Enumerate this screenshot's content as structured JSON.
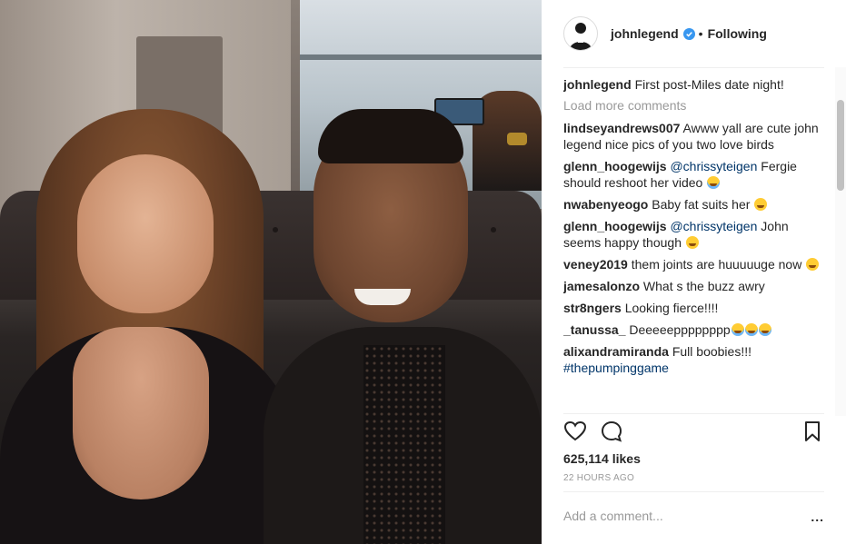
{
  "post": {
    "username": "johnlegend",
    "verified": true,
    "separator": "•",
    "follow_status": "Following",
    "caption_user": "johnlegend",
    "caption_text": "First post-Miles date night!"
  },
  "comments_section": {
    "load_more_label": "Load more comments",
    "items": [
      {
        "user": "lindseyandrews007",
        "text": "Awww yall are cute john legend nice pics of you two love birds"
      },
      {
        "user": "glenn_hoogewijs",
        "mention": "@chrissyteigen",
        "text": "Fergie should reshoot her video",
        "emoji": "laughing-crying-emoji"
      },
      {
        "user": "nwabenyeogo",
        "text": "Baby fat suits her",
        "emoji": "kiss-emoji"
      },
      {
        "user": "glenn_hoogewijs",
        "mention": "@chrissyteigen",
        "text": "John seems happy though",
        "emoji": "grin-emoji"
      },
      {
        "user": "veney2019",
        "text": "them joints are huuuuuge now",
        "emoji": "flushed-emoji"
      },
      {
        "user": "jamesalonzo",
        "text": "What s the buzz awry"
      },
      {
        "user": "str8ngers",
        "text": "Looking fierce!!!!"
      },
      {
        "user": "_tanussa_",
        "text": "Deeeeepppppppp",
        "emoji_count": 3,
        "emoji": "laughing-crying-emoji"
      },
      {
        "user": "alixandramiranda",
        "text": "Full boobies!!!",
        "hashtag": "#thepumpinggame"
      }
    ]
  },
  "stats": {
    "likes": "625,114 likes",
    "time": "22 HOURS AGO"
  },
  "compose": {
    "placeholder": "Add a comment...",
    "more_label": "..."
  },
  "colors": {
    "text": "#262626",
    "muted": "#999999",
    "link": "#003569",
    "verified": "#3897f0",
    "divider": "#efefef"
  },
  "icons": [
    "heart-icon",
    "comment-icon",
    "bookmark-icon",
    "verified-badge-icon",
    "more-options-icon"
  ]
}
